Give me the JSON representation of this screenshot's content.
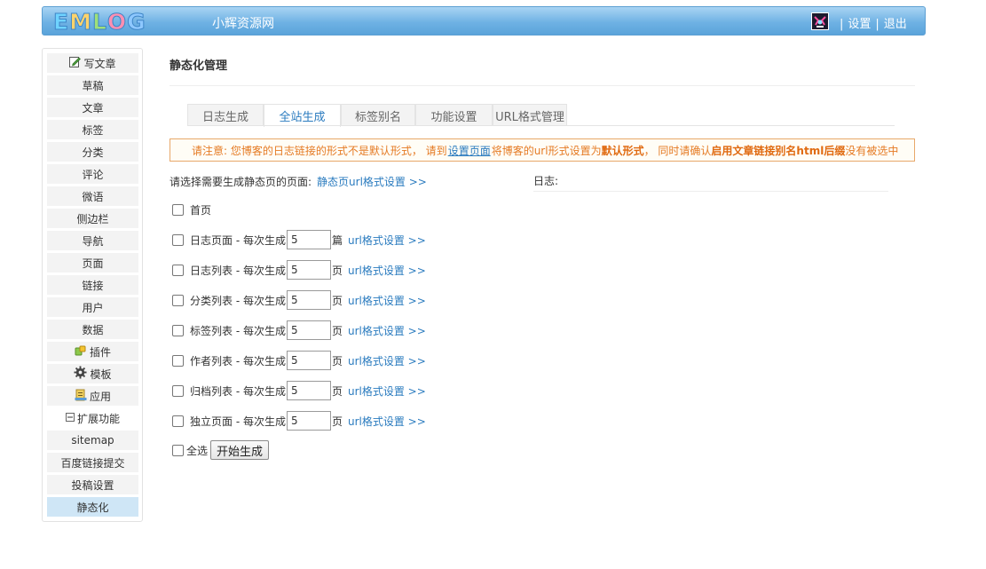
{
  "header": {
    "logo_letters": [
      "E",
      "M",
      "L",
      "O",
      "G"
    ],
    "site_name": "小辉资源网",
    "sep": "|",
    "settings_link": "设置",
    "logout_link": "退出"
  },
  "sidebar": {
    "items": [
      {
        "label": "写文章",
        "icon": "edit-icon"
      },
      {
        "label": "草稿"
      },
      {
        "label": "文章"
      },
      {
        "label": "标签"
      },
      {
        "label": "分类"
      },
      {
        "label": "评论"
      },
      {
        "label": "微语"
      },
      {
        "label": "侧边栏"
      },
      {
        "label": "导航"
      },
      {
        "label": "页面"
      },
      {
        "label": "链接"
      },
      {
        "label": "用户"
      },
      {
        "label": "数据"
      },
      {
        "label": "插件",
        "icon": "plugin-icon"
      },
      {
        "label": "模板",
        "icon": "gear-icon"
      },
      {
        "label": "应用",
        "icon": "app-icon"
      },
      {
        "label": "扩展功能",
        "icon": "collapse-icon"
      },
      {
        "label": "sitemap"
      },
      {
        "label": "百度链接提交"
      },
      {
        "label": "投稿设置"
      },
      {
        "label": "静态化",
        "active": true
      }
    ]
  },
  "main": {
    "title": "静态化管理",
    "tabs": [
      {
        "label": "日志生成"
      },
      {
        "label": "全站生成",
        "active": true
      },
      {
        "label": "标签别名"
      },
      {
        "label": "功能设置"
      },
      {
        "label": "URL格式管理"
      }
    ],
    "notice": {
      "part1": "请注意: 您博客的日志链接的形式不是默认形式，  请到",
      "link": "设置页面",
      "part2": "将博客的url形式设置为",
      "bold1": "默认形式",
      "part3": "，  同时请确认",
      "bold2": "启用文章链接别名html后缀",
      "part4": "没有被选中"
    },
    "choose_label": "请选择需要生成静态页的页面:",
    "choose_link": "静态页url格式设置 >>",
    "log_label": "日志:",
    "home_label": "首页",
    "rows": [
      {
        "label": "日志页面 - 每次生成",
        "value": "5",
        "unit": "篇",
        "link": "url格式设置 >>"
      },
      {
        "label": "日志列表 - 每次生成",
        "value": "5",
        "unit": "页",
        "link": "url格式设置 >>"
      },
      {
        "label": "分类列表 - 每次生成",
        "value": "5",
        "unit": "页",
        "link": "url格式设置 >>"
      },
      {
        "label": "标签列表 - 每次生成",
        "value": "5",
        "unit": "页",
        "link": "url格式设置 >>"
      },
      {
        "label": "作者列表 - 每次生成",
        "value": "5",
        "unit": "页",
        "link": "url格式设置 >>"
      },
      {
        "label": "归档列表 - 每次生成",
        "value": "5",
        "unit": "页",
        "link": "url格式设置 >>"
      },
      {
        "label": "独立页面 - 每次生成",
        "value": "5",
        "unit": "页",
        "link": "url格式设置 >>"
      }
    ],
    "select_all": "全选",
    "start_button": "开始生成"
  },
  "colors": {
    "header": "#6fb2e4",
    "link": "#2a7bbf",
    "notice_text": "#e57a23",
    "notice_border": "#e8a86a",
    "active_side": "#cfe6f6"
  }
}
